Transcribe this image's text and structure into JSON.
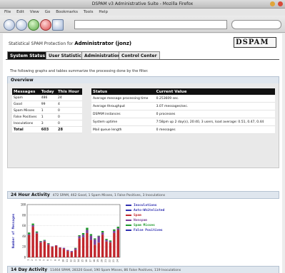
{
  "window": {
    "title": "DSPAM v3 Administrative Suite - Mozilla Firefox"
  },
  "menu": [
    "File",
    "Edit",
    "View",
    "Go",
    "Bookmarks",
    "Tools",
    "Help"
  ],
  "page": {
    "brand_prefix": "Statistical SPAM Protection for",
    "brand_user": "Administrator (jonz)",
    "logo": {
      "text": "DSPAM",
      "tagline": "statistical spam protection"
    },
    "tabs": [
      "System Status",
      "User Statistics",
      "Administration",
      "Control Center"
    ],
    "intro": "The following graphs and tables summarize the processing done by the filter."
  },
  "overview": {
    "title": "Overview",
    "messages": {
      "headers": [
        "Messages",
        "Today",
        "This Hour"
      ],
      "rows": [
        [
          "Spam",
          "486",
          "24"
        ],
        [
          "Good",
          "99",
          "4"
        ],
        [
          "Spam Misses",
          "1",
          "0"
        ],
        [
          "False Positives",
          "1",
          "0"
        ],
        [
          "Inoculations",
          "3",
          "0"
        ]
      ],
      "total": [
        "Total",
        "603",
        "28"
      ]
    },
    "status": {
      "headers": [
        "Status",
        "Current Value"
      ],
      "rows": [
        [
          "Average message processing time",
          "0.253609 sec."
        ],
        [
          "Average throughput",
          "3.07 messages/sec."
        ],
        [
          "DSPAM instances",
          "0 processes"
        ],
        [
          "System uptime",
          "7:58pm up 2 day(s), 20:40, 3 users, load average: 0.51, 0.47, 0.44"
        ],
        [
          "Mail queue length",
          "0 messages"
        ]
      ]
    }
  },
  "activity24": {
    "title": "24 Hour Activity",
    "summary": "472 SPAM, 462 Good, 1 Spam Misses, 1 False Positives, 3 Inoculations"
  },
  "activity14": {
    "title": "14 Day Activity",
    "summary": "11464 SPAM, 28320 Good, 190 Spam Misses, 86 False Positives, 119 Inoculations"
  },
  "chart_data": {
    "type": "bar",
    "title": "",
    "xlabel": "Hour of the Day",
    "ylabel": "Number of Messages",
    "ylim": [
      0,
      100
    ],
    "yticks": [
      0,
      20,
      40,
      60,
      80,
      100
    ],
    "grid": true,
    "legend_position": "right",
    "categories": [
      "1",
      "2",
      "3",
      "4",
      "5",
      "6",
      "7",
      "8",
      "9",
      "10",
      "11",
      "12",
      "13",
      "14",
      "15",
      "16",
      "17",
      "18",
      "19",
      "20",
      "21",
      "22",
      "23",
      "24"
    ],
    "series": [
      {
        "name": "Spam",
        "color": "#c0262c",
        "values": [
          42,
          58,
          45,
          28,
          30,
          24,
          20,
          22,
          18,
          16,
          12,
          10,
          14,
          36,
          38,
          46,
          33,
          24,
          28,
          43,
          30,
          28,
          46,
          52
        ]
      },
      {
        "name": "Nonspam",
        "color": "#7a3d97",
        "values": [
          2,
          3,
          2,
          2,
          2,
          2,
          1,
          1,
          1,
          2,
          2,
          2,
          3,
          4,
          5,
          6,
          8,
          10,
          12,
          4,
          3,
          2,
          4,
          3
        ]
      },
      {
        "name": "Spam Misses",
        "color": "#1f9a2c",
        "values": [
          3,
          3,
          2,
          1,
          1,
          1,
          0,
          0,
          0,
          0,
          0,
          0,
          1,
          2,
          3,
          4,
          3,
          2,
          1,
          3,
          2,
          2,
          3,
          3
        ]
      }
    ],
    "legend": [
      {
        "name": "Inoculations",
        "color": "#2f2fb0"
      },
      {
        "name": "Auto-Whitelisted",
        "color": "#2f2fb0"
      },
      {
        "name": "Spam",
        "color": "#c0262c"
      },
      {
        "name": "Nonspam",
        "color": "#7a3d97"
      },
      {
        "name": "Spam Misses",
        "color": "#1f9a2c"
      },
      {
        "name": "False Positives",
        "color": "#2f2fb0"
      }
    ]
  }
}
